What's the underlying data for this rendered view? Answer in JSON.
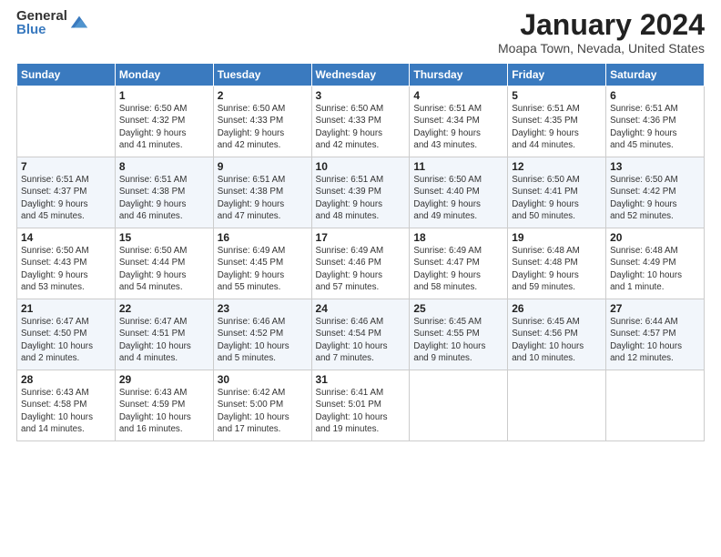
{
  "logo": {
    "general": "General",
    "blue": "Blue"
  },
  "title": "January 2024",
  "location": "Moapa Town, Nevada, United States",
  "days_of_week": [
    "Sunday",
    "Monday",
    "Tuesday",
    "Wednesday",
    "Thursday",
    "Friday",
    "Saturday"
  ],
  "weeks": [
    [
      {
        "day": "",
        "sunrise": "",
        "sunset": "",
        "daylight": ""
      },
      {
        "day": "1",
        "sunrise": "Sunrise: 6:50 AM",
        "sunset": "Sunset: 4:32 PM",
        "daylight": "Daylight: 9 hours and 41 minutes."
      },
      {
        "day": "2",
        "sunrise": "Sunrise: 6:50 AM",
        "sunset": "Sunset: 4:33 PM",
        "daylight": "Daylight: 9 hours and 42 minutes."
      },
      {
        "day": "3",
        "sunrise": "Sunrise: 6:50 AM",
        "sunset": "Sunset: 4:33 PM",
        "daylight": "Daylight: 9 hours and 42 minutes."
      },
      {
        "day": "4",
        "sunrise": "Sunrise: 6:51 AM",
        "sunset": "Sunset: 4:34 PM",
        "daylight": "Daylight: 9 hours and 43 minutes."
      },
      {
        "day": "5",
        "sunrise": "Sunrise: 6:51 AM",
        "sunset": "Sunset: 4:35 PM",
        "daylight": "Daylight: 9 hours and 44 minutes."
      },
      {
        "day": "6",
        "sunrise": "Sunrise: 6:51 AM",
        "sunset": "Sunset: 4:36 PM",
        "daylight": "Daylight: 9 hours and 45 minutes."
      }
    ],
    [
      {
        "day": "7",
        "sunrise": "Sunrise: 6:51 AM",
        "sunset": "Sunset: 4:37 PM",
        "daylight": "Daylight: 9 hours and 45 minutes."
      },
      {
        "day": "8",
        "sunrise": "Sunrise: 6:51 AM",
        "sunset": "Sunset: 4:38 PM",
        "daylight": "Daylight: 9 hours and 46 minutes."
      },
      {
        "day": "9",
        "sunrise": "Sunrise: 6:51 AM",
        "sunset": "Sunset: 4:38 PM",
        "daylight": "Daylight: 9 hours and 47 minutes."
      },
      {
        "day": "10",
        "sunrise": "Sunrise: 6:51 AM",
        "sunset": "Sunset: 4:39 PM",
        "daylight": "Daylight: 9 hours and 48 minutes."
      },
      {
        "day": "11",
        "sunrise": "Sunrise: 6:50 AM",
        "sunset": "Sunset: 4:40 PM",
        "daylight": "Daylight: 9 hours and 49 minutes."
      },
      {
        "day": "12",
        "sunrise": "Sunrise: 6:50 AM",
        "sunset": "Sunset: 4:41 PM",
        "daylight": "Daylight: 9 hours and 50 minutes."
      },
      {
        "day": "13",
        "sunrise": "Sunrise: 6:50 AM",
        "sunset": "Sunset: 4:42 PM",
        "daylight": "Daylight: 9 hours and 52 minutes."
      }
    ],
    [
      {
        "day": "14",
        "sunrise": "Sunrise: 6:50 AM",
        "sunset": "Sunset: 4:43 PM",
        "daylight": "Daylight: 9 hours and 53 minutes."
      },
      {
        "day": "15",
        "sunrise": "Sunrise: 6:50 AM",
        "sunset": "Sunset: 4:44 PM",
        "daylight": "Daylight: 9 hours and 54 minutes."
      },
      {
        "day": "16",
        "sunrise": "Sunrise: 6:49 AM",
        "sunset": "Sunset: 4:45 PM",
        "daylight": "Daylight: 9 hours and 55 minutes."
      },
      {
        "day": "17",
        "sunrise": "Sunrise: 6:49 AM",
        "sunset": "Sunset: 4:46 PM",
        "daylight": "Daylight: 9 hours and 57 minutes."
      },
      {
        "day": "18",
        "sunrise": "Sunrise: 6:49 AM",
        "sunset": "Sunset: 4:47 PM",
        "daylight": "Daylight: 9 hours and 58 minutes."
      },
      {
        "day": "19",
        "sunrise": "Sunrise: 6:48 AM",
        "sunset": "Sunset: 4:48 PM",
        "daylight": "Daylight: 9 hours and 59 minutes."
      },
      {
        "day": "20",
        "sunrise": "Sunrise: 6:48 AM",
        "sunset": "Sunset: 4:49 PM",
        "daylight": "Daylight: 10 hours and 1 minute."
      }
    ],
    [
      {
        "day": "21",
        "sunrise": "Sunrise: 6:47 AM",
        "sunset": "Sunset: 4:50 PM",
        "daylight": "Daylight: 10 hours and 2 minutes."
      },
      {
        "day": "22",
        "sunrise": "Sunrise: 6:47 AM",
        "sunset": "Sunset: 4:51 PM",
        "daylight": "Daylight: 10 hours and 4 minutes."
      },
      {
        "day": "23",
        "sunrise": "Sunrise: 6:46 AM",
        "sunset": "Sunset: 4:52 PM",
        "daylight": "Daylight: 10 hours and 5 minutes."
      },
      {
        "day": "24",
        "sunrise": "Sunrise: 6:46 AM",
        "sunset": "Sunset: 4:54 PM",
        "daylight": "Daylight: 10 hours and 7 minutes."
      },
      {
        "day": "25",
        "sunrise": "Sunrise: 6:45 AM",
        "sunset": "Sunset: 4:55 PM",
        "daylight": "Daylight: 10 hours and 9 minutes."
      },
      {
        "day": "26",
        "sunrise": "Sunrise: 6:45 AM",
        "sunset": "Sunset: 4:56 PM",
        "daylight": "Daylight: 10 hours and 10 minutes."
      },
      {
        "day": "27",
        "sunrise": "Sunrise: 6:44 AM",
        "sunset": "Sunset: 4:57 PM",
        "daylight": "Daylight: 10 hours and 12 minutes."
      }
    ],
    [
      {
        "day": "28",
        "sunrise": "Sunrise: 6:43 AM",
        "sunset": "Sunset: 4:58 PM",
        "daylight": "Daylight: 10 hours and 14 minutes."
      },
      {
        "day": "29",
        "sunrise": "Sunrise: 6:43 AM",
        "sunset": "Sunset: 4:59 PM",
        "daylight": "Daylight: 10 hours and 16 minutes."
      },
      {
        "day": "30",
        "sunrise": "Sunrise: 6:42 AM",
        "sunset": "Sunset: 5:00 PM",
        "daylight": "Daylight: 10 hours and 17 minutes."
      },
      {
        "day": "31",
        "sunrise": "Sunrise: 6:41 AM",
        "sunset": "Sunset: 5:01 PM",
        "daylight": "Daylight: 10 hours and 19 minutes."
      },
      {
        "day": "",
        "sunrise": "",
        "sunset": "",
        "daylight": ""
      },
      {
        "day": "",
        "sunrise": "",
        "sunset": "",
        "daylight": ""
      },
      {
        "day": "",
        "sunrise": "",
        "sunset": "",
        "daylight": ""
      }
    ]
  ]
}
